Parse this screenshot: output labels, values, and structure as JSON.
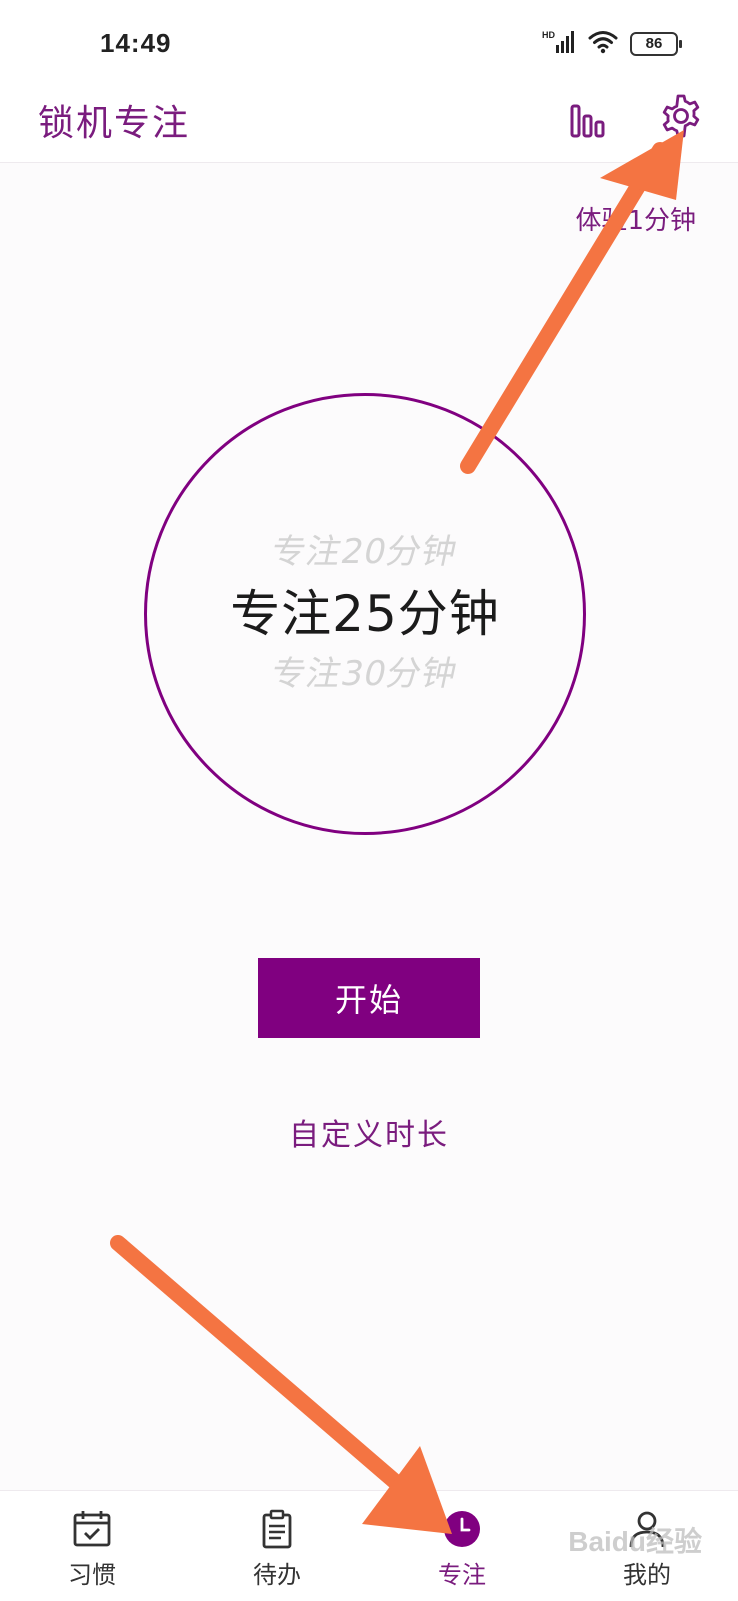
{
  "status_bar": {
    "time": "14:49",
    "network": "HD",
    "battery": "86"
  },
  "header": {
    "title": "锁机专注",
    "stats_icon": "bar-chart-icon",
    "settings_icon": "gear-icon"
  },
  "trial_link": "体验1分钟",
  "picker": {
    "prev": "专注20分钟",
    "current": "专注25分钟",
    "next": "专注30分钟"
  },
  "start_button": "开始",
  "custom_duration": "自定义时长",
  "nav": {
    "items": [
      {
        "label": "习惯",
        "icon": "calendar-check-icon"
      },
      {
        "label": "待办",
        "icon": "clipboard-icon"
      },
      {
        "label": "专注",
        "icon": "clock-icon",
        "active": true
      },
      {
        "label": "我的",
        "icon": "user-icon"
      }
    ]
  },
  "colors": {
    "accent": "#800080",
    "accent_text": "#7a1c7e",
    "annotation_arrow": "#f47442"
  }
}
